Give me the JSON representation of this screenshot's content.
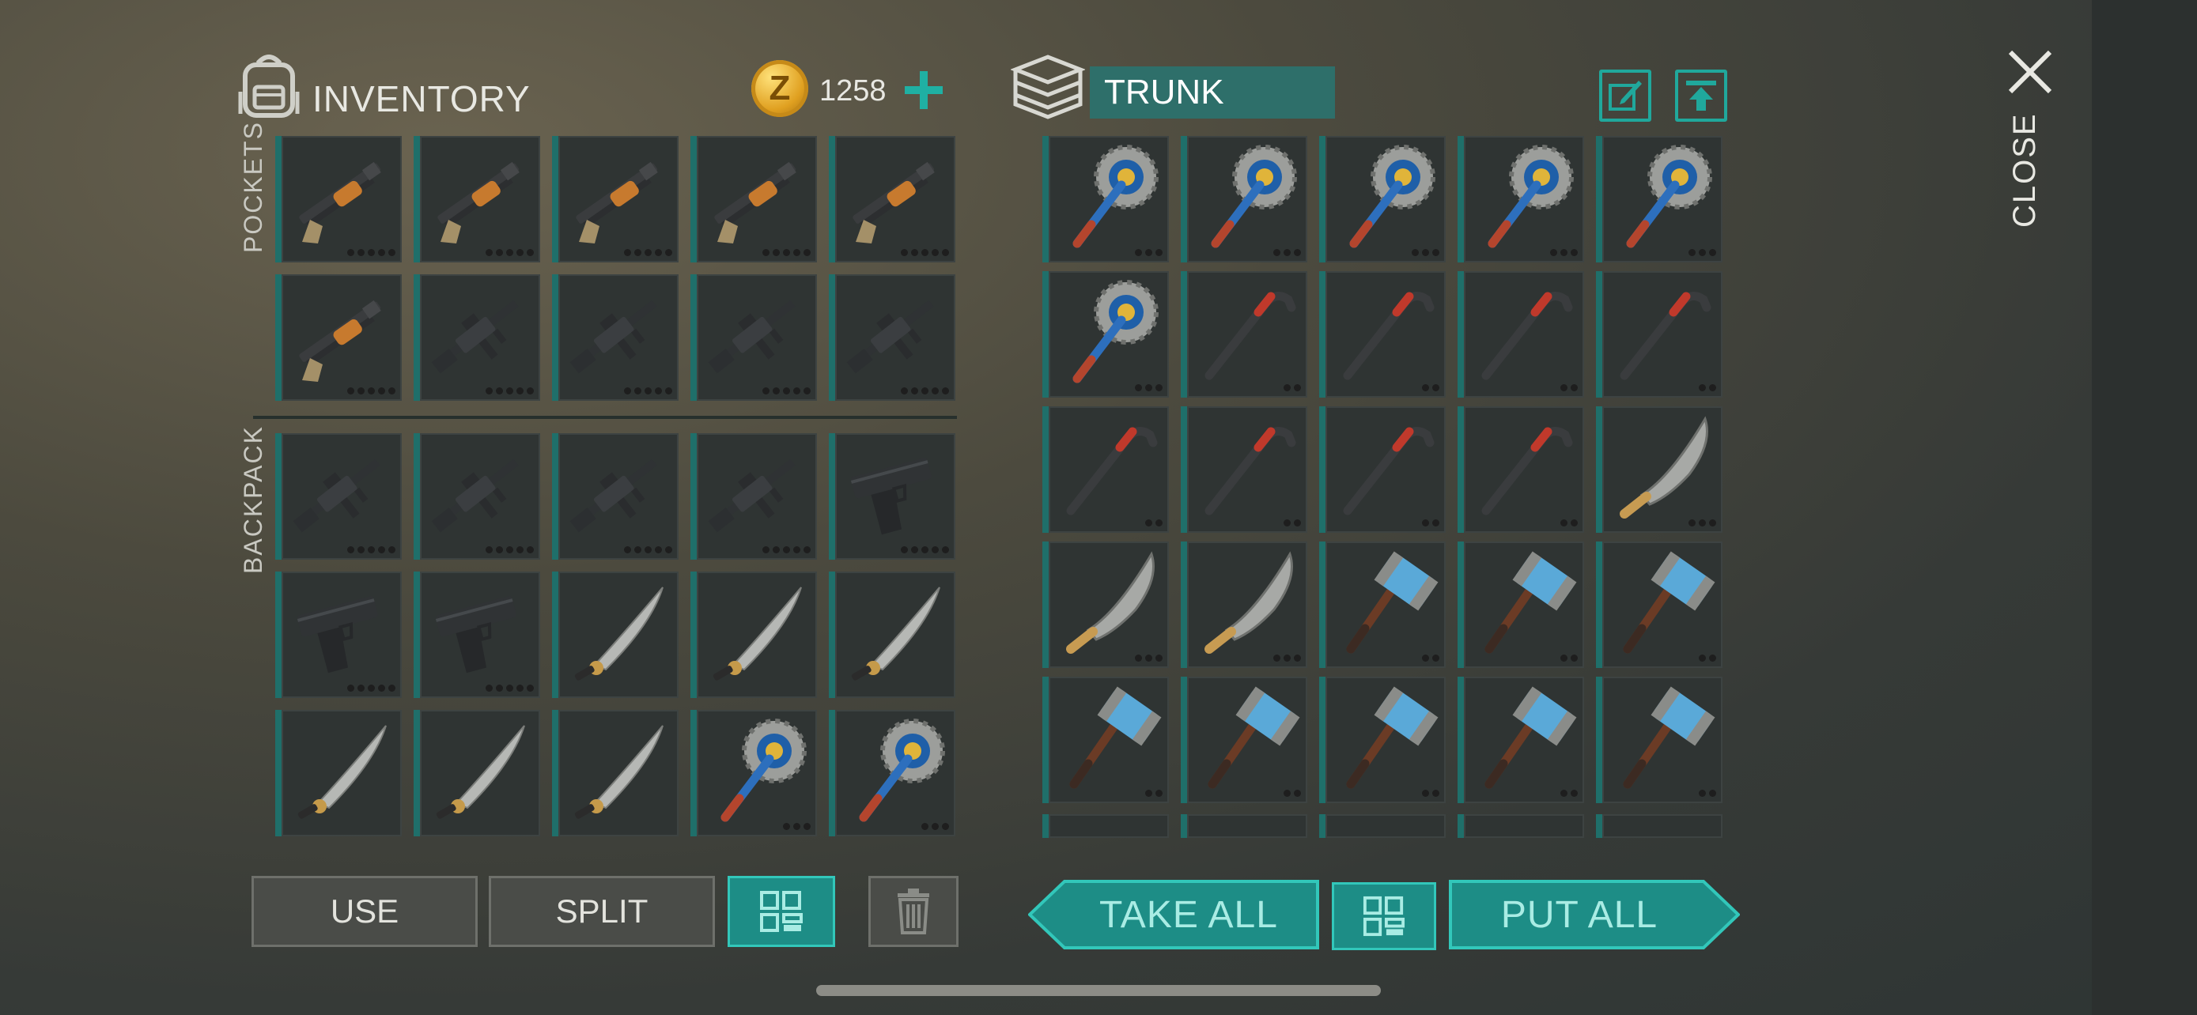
{
  "inventory": {
    "title": "INVENTORY",
    "coins": "1258",
    "coin_symbol": "Z",
    "pockets_label": "POCKETS",
    "backpack_label": "BACKPACK",
    "pockets": [
      {
        "item": "shotgun",
        "dots": 5
      },
      {
        "item": "shotgun",
        "dots": 5
      },
      {
        "item": "shotgun",
        "dots": 5
      },
      {
        "item": "shotgun",
        "dots": 5
      },
      {
        "item": "shotgun",
        "dots": 5
      },
      {
        "item": "shotgun",
        "dots": 5
      },
      {
        "item": "assault-rifle",
        "dots": 5
      },
      {
        "item": "assault-rifle",
        "dots": 5
      },
      {
        "item": "assault-rifle",
        "dots": 5
      },
      {
        "item": "assault-rifle",
        "dots": 5
      }
    ],
    "backpack": [
      {
        "item": "assault-rifle",
        "dots": 5
      },
      {
        "item": "assault-rifle",
        "dots": 5
      },
      {
        "item": "assault-rifle",
        "dots": 5
      },
      {
        "item": "assault-rifle",
        "dots": 5
      },
      {
        "item": "pistol",
        "dots": 5
      },
      {
        "item": "pistol",
        "dots": 5
      },
      {
        "item": "pistol",
        "dots": 5
      },
      {
        "item": "katana",
        "dots": 0
      },
      {
        "item": "katana",
        "dots": 0
      },
      {
        "item": "katana",
        "dots": 0
      },
      {
        "item": "katana",
        "dots": 0
      },
      {
        "item": "katana",
        "dots": 0
      },
      {
        "item": "katana",
        "dots": 0
      },
      {
        "item": "saw-mace",
        "dots": 3
      },
      {
        "item": "saw-mace",
        "dots": 3
      }
    ]
  },
  "trunk": {
    "title": "TRUNK",
    "slots": [
      {
        "item": "saw-mace",
        "dots": 3
      },
      {
        "item": "saw-mace",
        "dots": 3
      },
      {
        "item": "saw-mace",
        "dots": 3
      },
      {
        "item": "saw-mace",
        "dots": 3
      },
      {
        "item": "saw-mace",
        "dots": 3
      },
      {
        "item": "saw-mace",
        "dots": 3
      },
      {
        "item": "crowbar",
        "dots": 2
      },
      {
        "item": "crowbar",
        "dots": 2
      },
      {
        "item": "crowbar",
        "dots": 2
      },
      {
        "item": "crowbar",
        "dots": 2
      },
      {
        "item": "crowbar",
        "dots": 2
      },
      {
        "item": "crowbar",
        "dots": 2
      },
      {
        "item": "crowbar",
        "dots": 2
      },
      {
        "item": "crowbar",
        "dots": 2
      },
      {
        "item": "machete",
        "dots": 3
      },
      {
        "item": "machete",
        "dots": 3
      },
      {
        "item": "machete",
        "dots": 3
      },
      {
        "item": "sledgehammer",
        "dots": 2
      },
      {
        "item": "sledgehammer",
        "dots": 2
      },
      {
        "item": "sledgehammer",
        "dots": 2
      },
      {
        "item": "sledgehammer",
        "dots": 2
      },
      {
        "item": "sledgehammer",
        "dots": 2
      },
      {
        "item": "sledgehammer",
        "dots": 2
      },
      {
        "item": "sledgehammer",
        "dots": 2
      },
      {
        "item": "sledgehammer",
        "dots": 2
      }
    ]
  },
  "buttons": {
    "use": "USE",
    "split": "SPLIT",
    "take_all": "TAKE ALL",
    "put_all": "PUT ALL",
    "close": "CLOSE"
  },
  "icons": {
    "backpack": "backpack-icon",
    "coin": "coin-icon",
    "plus": "plus-icon",
    "trunk": "trunk-stack-icon",
    "rename": "edit-icon",
    "upload": "upload-icon",
    "close": "close-icon",
    "sort": "sort-grid-icon",
    "trash": "trash-icon"
  },
  "colors": {
    "accent": "#1fb0a3",
    "teal_field": "#2e6f6a",
    "slot_bg": "#2f3433",
    "coin": "#e0a020"
  }
}
